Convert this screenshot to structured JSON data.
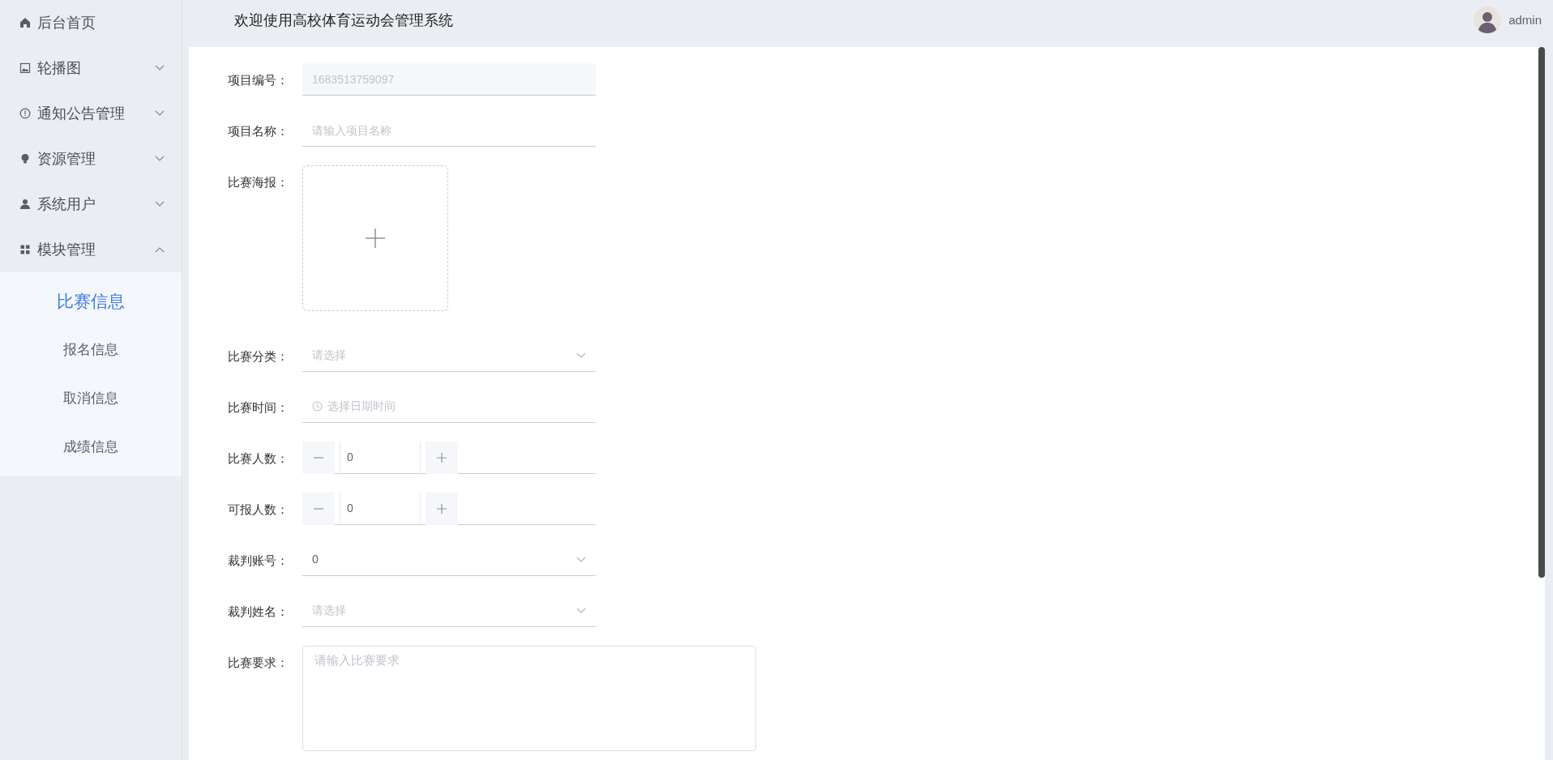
{
  "sidebar": {
    "items": [
      {
        "label": "后台首页",
        "kind": "home"
      },
      {
        "label": "轮播图",
        "kind": "picture",
        "expanded": false
      },
      {
        "label": "通知公告管理",
        "kind": "info",
        "expanded": false
      },
      {
        "label": "资源管理",
        "kind": "bulb",
        "expanded": false
      },
      {
        "label": "系统用户",
        "kind": "user",
        "expanded": false
      },
      {
        "label": "模块管理",
        "kind": "grid",
        "expanded": true,
        "children": [
          {
            "label": "比赛信息",
            "selected": true
          },
          {
            "label": "报名信息",
            "selected": false
          },
          {
            "label": "取消信息",
            "selected": false
          },
          {
            "label": "成绩信息",
            "selected": false
          }
        ]
      }
    ]
  },
  "header": {
    "title": "欢迎使用高校体育运动会管理系统",
    "user": "admin"
  },
  "form": {
    "fields": [
      {
        "kind": "text",
        "label": "项目编号：",
        "value": "1683513759097",
        "disabled": true
      },
      {
        "kind": "text",
        "label": "项目名称：",
        "placeholder": "请输入项目名称"
      },
      {
        "kind": "upload",
        "label": "比赛海报："
      },
      {
        "kind": "select",
        "label": "比赛分类：",
        "placeholder": "请选择"
      },
      {
        "kind": "datetime",
        "label": "比赛时间：",
        "placeholder": "选择日期时间"
      },
      {
        "kind": "number",
        "label": "比赛人数：",
        "value": "0"
      },
      {
        "kind": "number",
        "label": "可报人数：",
        "value": "0"
      },
      {
        "kind": "select",
        "label": "裁判账号：",
        "value": "0"
      },
      {
        "kind": "select",
        "label": "裁判姓名：",
        "placeholder": "请选择"
      },
      {
        "kind": "textarea",
        "label": "比赛要求：",
        "placeholder": "请输入比赛要求"
      }
    ]
  }
}
